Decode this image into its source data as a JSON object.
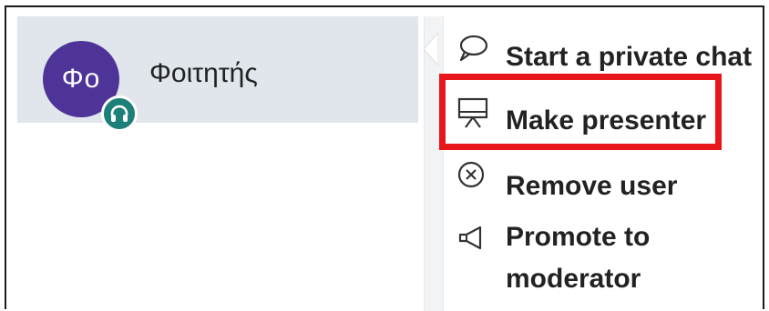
{
  "user": {
    "avatar_initials": "Φο",
    "name": "Φοιτητής",
    "avatar_color": "#4e3499",
    "badge_icon": "headset-icon",
    "badge_color": "#1c7f78"
  },
  "menu": {
    "items": [
      {
        "label": "Start a private chat",
        "icon": "chat-bubble-icon"
      },
      {
        "label": "Make presenter",
        "icon": "presentation-board-icon"
      },
      {
        "label": "Remove user",
        "icon": "close-circle-icon"
      },
      {
        "label_line1": "Promote to",
        "label_line2": "moderator",
        "icon": "megaphone-icon"
      }
    ]
  },
  "highlight_color": "#e8151b"
}
